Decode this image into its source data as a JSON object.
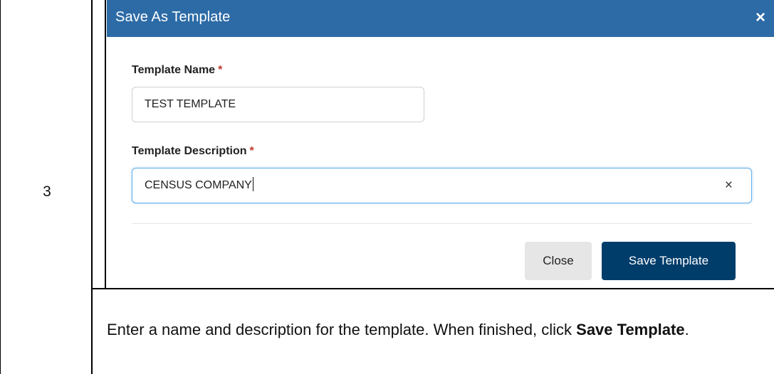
{
  "step": {
    "number": "3"
  },
  "modal": {
    "title": "Save As Template",
    "close_icon": "×",
    "template_name": {
      "label": "Template Name",
      "required_mark": "*",
      "value": "TEST TEMPLATE"
    },
    "template_description": {
      "label": "Template Description",
      "required_mark": "*",
      "value": "CENSUS COMPANY",
      "clear_icon": "×"
    },
    "buttons": {
      "close_label": "Close",
      "save_label": "Save Template"
    }
  },
  "instruction": {
    "text_before": "Enter a name and description for the template. When finished, click",
    "bold": "Save Template",
    "text_after": "."
  },
  "colors": {
    "header": "#2d6ba6",
    "save_button": "#003d6b",
    "required": "#c0392b"
  }
}
